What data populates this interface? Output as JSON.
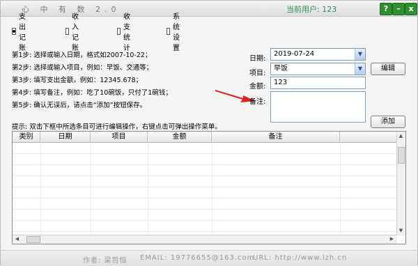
{
  "window": {
    "title": "心 中 有 数   2.0",
    "current_user": "当前用户: 123",
    "help_label": "?",
    "minimize_label": "–",
    "close_label": "x"
  },
  "tabs": [
    {
      "label": "支出记账",
      "selected": true
    },
    {
      "label": "收入记账",
      "selected": false
    },
    {
      "label": "收支统计",
      "selected": false
    },
    {
      "label": "系统设置",
      "selected": false
    }
  ],
  "steps": [
    "第1步: 选择或输入日期，格式如2007-10-22；",
    "第2步: 选择或输入项目，例如：早饭、交通等；",
    "第3步: 填写支出金额，例如：12345.678；",
    "第4步: 填写备注，例如：吃了10碗饭，只付了1碗钱；",
    "第5步: 确认无误后，请点击“添加”按钮保存。"
  ],
  "form": {
    "date_label": "日期:",
    "date_value": "2019-07-24",
    "item_label": "项目:",
    "item_value": "早饭",
    "amount_label": "金额:",
    "amount_value": "123",
    "note_label": "备注:",
    "note_value": "",
    "edit_button": "编辑",
    "add_button": "添加"
  },
  "hint": "提示: 双击下框中所选条目可进行编辑操作，右键点击可弹出操作菜单。",
  "table": {
    "columns": [
      "类别",
      "日期",
      "项目",
      "金额",
      "备注"
    ],
    "rows": []
  },
  "footer": {
    "author": "作者: 梁哲恒",
    "email": "EMAIL: 19776655@163.com",
    "url": "URL: http://www.lzh.cn"
  },
  "colors": {
    "accent_green": "#2e8b57",
    "arrow_red": "#e02020"
  }
}
